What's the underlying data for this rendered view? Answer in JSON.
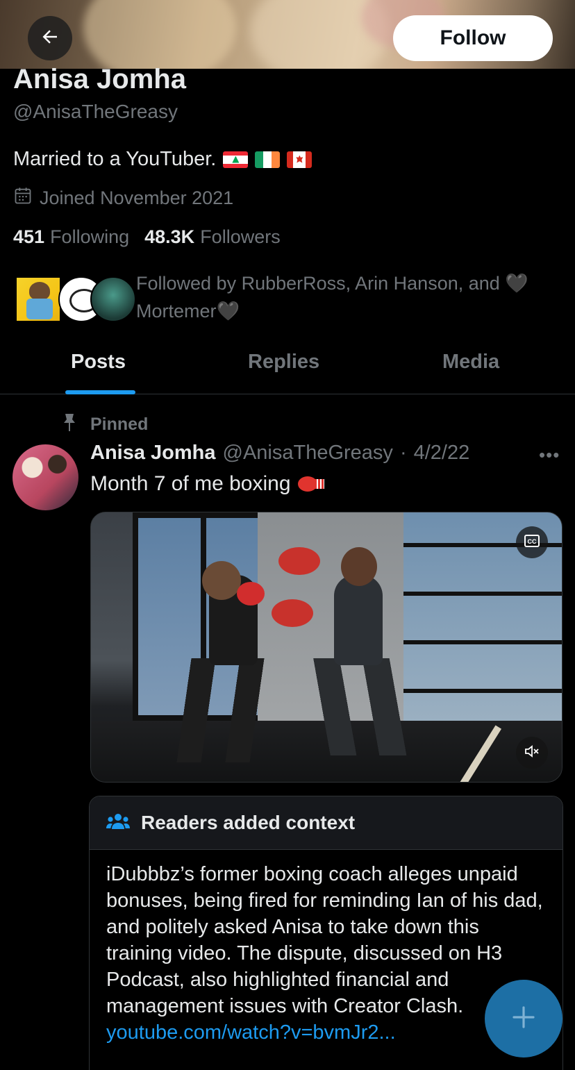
{
  "header": {
    "follow_label": "Follow"
  },
  "profile": {
    "name": "Anisa Jomha",
    "handle": "@AnisaTheGreasy",
    "bio": "Married to a YouTuber.",
    "bio_flags": [
      "lebanon-flag",
      "ireland-flag",
      "canada-flag"
    ],
    "joined": "Joined November 2021",
    "following_count": "451",
    "following_label": "Following",
    "followers_count": "48.3K",
    "followers_label": "Followers",
    "followed_by_line1": "Followed by RubberRoss, Arin Hanson, and 🖤",
    "followed_by_line2": "Mortemer🖤"
  },
  "tabs": [
    {
      "label": "Posts",
      "active": true
    },
    {
      "label": "Replies",
      "active": false
    },
    {
      "label": "Media",
      "active": false
    }
  ],
  "post": {
    "pinned_label": "Pinned",
    "author_name": "Anisa Jomha",
    "author_handle": "@AnisaTheGreasy",
    "separator": "·",
    "date": "4/2/22",
    "text": "Month 7 of me boxing",
    "media": {
      "cc_label": "CC"
    },
    "context": {
      "title": "Readers added context",
      "body": "iDubbbz’s former boxing coach alleges unpaid bonuses, being fired for reminding Ian of his dad, and politely asked Anisa to take down this training video. The dispute, discussed on H3 Podcast, also highlighted financial and management issues with Creator Clash.",
      "link": "youtube.com/watch?v=bvmJr2..."
    }
  },
  "colors": {
    "accent": "#1d9bf0",
    "muted": "#71767b",
    "text": "#e7e9ea",
    "background": "#000000"
  }
}
